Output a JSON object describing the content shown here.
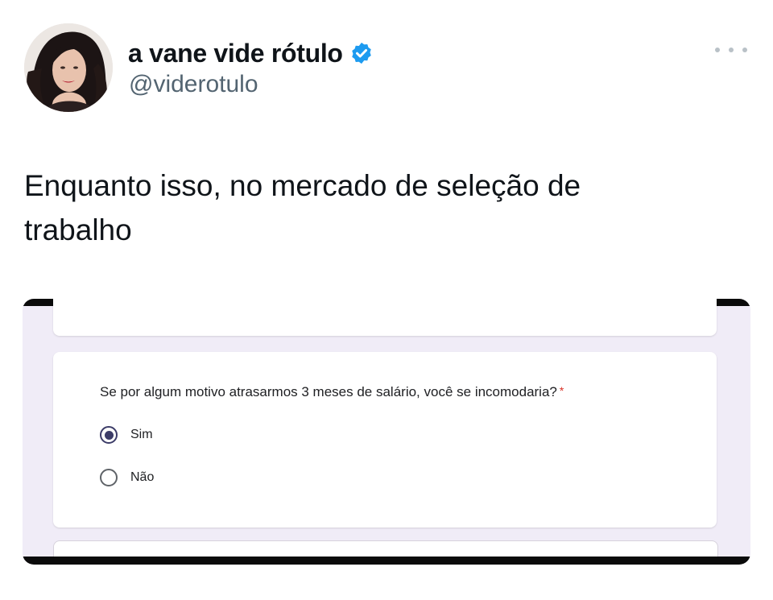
{
  "tweet": {
    "author": {
      "display_name": "a vane vide rótulo",
      "handle": "@viderotulo",
      "verified": true,
      "verified_icon": "verified-badge-icon",
      "avatar": "profile-photo"
    },
    "more_icon": "more-horizontal-icon",
    "text_line1": "Enquanto isso, no mercado de seleção de",
    "text_line2": "trabalho",
    "colors": {
      "text": "#0f1419",
      "secondary": "#536471",
      "verified_blue": "#1d9bf0"
    }
  },
  "form": {
    "question": "Se por algum motivo atrasarmos 3 meses de salário, você se incomodaria?",
    "required_mark": "*",
    "options": [
      {
        "label": "Sim",
        "selected": true
      },
      {
        "label": "Não",
        "selected": false
      }
    ],
    "colors": {
      "background": "#f0ecf7",
      "radio_selected": "#3c3c68",
      "required": "#d93025"
    }
  }
}
